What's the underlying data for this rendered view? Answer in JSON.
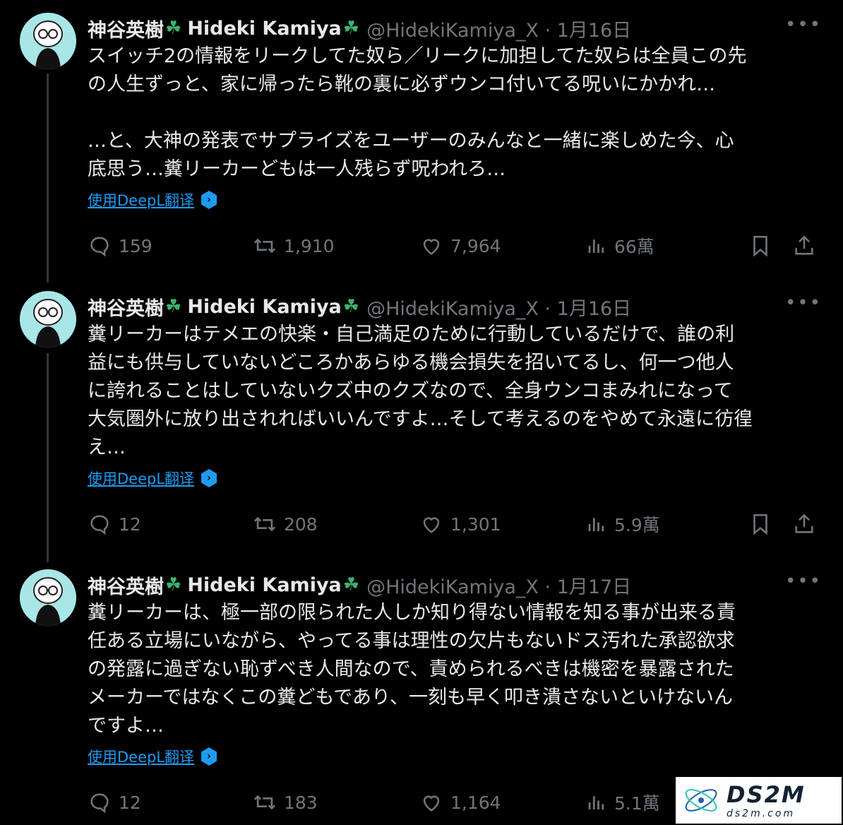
{
  "tweets": [
    {
      "author_name": "神谷英樹",
      "author_name2": "Hideki Kamiya",
      "handle_date": "@HidekiKamiya_X · 1月16日",
      "text": "スイッチ2の情報をリークしてた奴ら／リークに加担してた奴らは全員この先\nの人生ずっと、家に帰ったら靴の裏に必ずウンコ付いてる呪いにかかれ…\n\n…と、大神の発表でサプライズをユーザーのみんなと一緒に楽しめた今、心\n底思う…糞リーカーどもは一人残らず呪われろ…",
      "translate": "使用DeepL翻译",
      "replies": "159",
      "retweets": "1,910",
      "likes": "7,964",
      "views": "66萬"
    },
    {
      "author_name": "神谷英樹",
      "author_name2": "Hideki Kamiya",
      "handle_date": "@HidekiKamiya_X · 1月16日",
      "text": "糞リーカーはテメエの快楽・自己満足のために行動しているだけで、誰の利\n益にも供与していないどころかあらゆる機会損失を招いてるし、何一つ他人\nに誇れることはしていないクズ中のクズなので、全身ウンコまみれになって\n大気圏外に放り出されればいいんですよ…そして考えるのをやめて永遠に彷徨\nえ…",
      "translate": "使用DeepL翻译",
      "replies": "12",
      "retweets": "208",
      "likes": "1,301",
      "views": "5.9萬"
    },
    {
      "author_name": "神谷英樹",
      "author_name2": "Hideki Kamiya",
      "handle_date": "@HidekiKamiya_X · 1月17日",
      "text": "糞リーカーは、極一部の限られた人しか知り得ない情報を知る事が出来る責\n任ある立場にいながら、やってる事は理性の欠片もないドス汚れた承認欲求\nの発露に過ぎない恥ずべき人間なので、責められるべきは機密を暴露された\nメーカーではなくこの糞どもであり、一刻も早く叩き潰さないといけないん\nですよ…",
      "translate": "使用DeepL翻译",
      "replies": "12",
      "retweets": "183",
      "likes": "1,164",
      "views": "5.1萬"
    }
  ],
  "watermark": {
    "logo": "DS2M",
    "url": "ds2m.com"
  },
  "icons": [
    "clover-icon",
    "more-icon",
    "reply-icon",
    "retweet-icon",
    "like-icon",
    "views-icon",
    "bookmark-icon",
    "share-icon",
    "deepl-icon"
  ]
}
